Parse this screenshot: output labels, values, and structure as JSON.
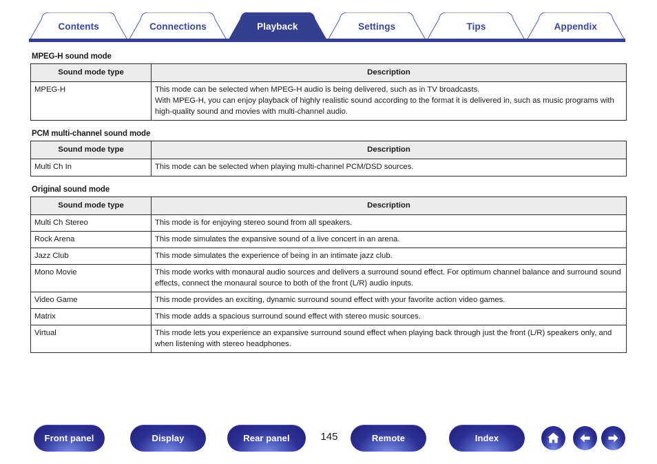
{
  "tabs": [
    {
      "label": "Contents",
      "active": false
    },
    {
      "label": "Connections",
      "active": false
    },
    {
      "label": "Playback",
      "active": true
    },
    {
      "label": "Settings",
      "active": false
    },
    {
      "label": "Tips",
      "active": false
    },
    {
      "label": "Appendix",
      "active": false
    }
  ],
  "columns": {
    "type": "Sound mode type",
    "description": "Description"
  },
  "sections": [
    {
      "title": "MPEG-H sound mode",
      "rows": [
        {
          "type": "MPEG-H",
          "lines": [
            "This mode can be selected when MPEG-H audio is being delivered, such as in TV broadcasts.",
            "With MPEG-H, you can enjoy playback of highly realistic sound according to the format it is delivered in, such as music programs with high-quality sound and movies with multi-channel audio."
          ]
        }
      ]
    },
    {
      "title": "PCM multi-channel sound mode",
      "rows": [
        {
          "type": "Multi Ch In",
          "lines": [
            "This mode can be selected when playing multi-channel PCM/DSD sources."
          ]
        }
      ]
    },
    {
      "title": "Original sound mode",
      "rows": [
        {
          "type": "Multi Ch Stereo",
          "lines": [
            "This mode is for enjoying stereo sound from all speakers."
          ]
        },
        {
          "type": "Rock Arena",
          "lines": [
            "This mode simulates the expansive sound of a live concert in an arena."
          ]
        },
        {
          "type": "Jazz Club",
          "lines": [
            "This mode simulates the experience of being in an intimate jazz club."
          ]
        },
        {
          "type": "Mono Movie",
          "lines": [
            "This mode works with monaural audio sources and delivers a surround sound effect. For optimum channel balance and surround sound effects, connect the monaural source to both of the front (L/R) audio inputs."
          ]
        },
        {
          "type": "Video Game",
          "lines": [
            "This mode provides an exciting, dynamic surround sound effect with your favorite action video games."
          ]
        },
        {
          "type": "Matrix",
          "lines": [
            "This mode adds a spacious surround sound effect with stereo music sources."
          ]
        },
        {
          "type": "Virtual",
          "lines": [
            "This mode lets you experience an expansive surround sound effect when playing back through just the front (L/R) speakers only, and when listening with stereo headphones."
          ]
        }
      ]
    }
  ],
  "footer": {
    "buttons": [
      {
        "label": "Front panel"
      },
      {
        "label": "Display"
      },
      {
        "label": "Rear panel"
      },
      {
        "label": "Remote"
      },
      {
        "label": "Index"
      }
    ],
    "page_number": "145",
    "icons": [
      {
        "name": "home-icon"
      },
      {
        "name": "arrow-left-icon"
      },
      {
        "name": "arrow-right-icon"
      }
    ]
  },
  "colors": {
    "brand_blue": "#353f8f",
    "tab_text": "#3b45a0",
    "header_fill": "#ececec"
  }
}
